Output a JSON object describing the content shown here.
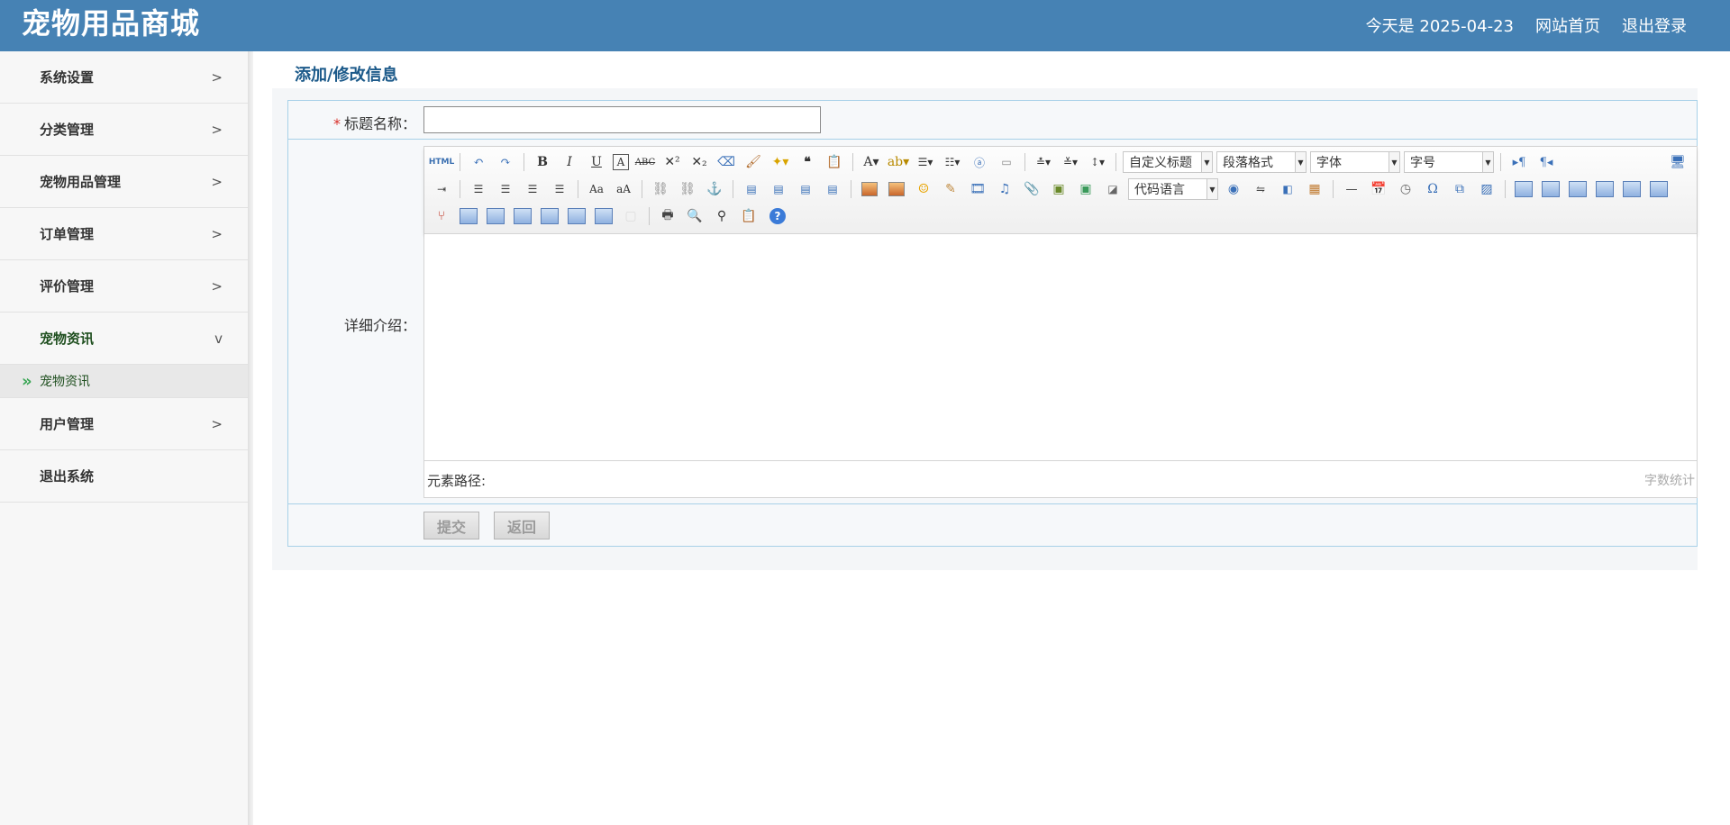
{
  "header": {
    "brand": "宠物用品商城",
    "date_text": "今天是 2025-04-23",
    "home_link": "网站首页",
    "logout_link": "退出登录"
  },
  "sidebar": {
    "items": [
      {
        "label": "系统设置",
        "chevron": ">"
      },
      {
        "label": "分类管理",
        "chevron": ">"
      },
      {
        "label": "宠物用品管理",
        "chevron": ">"
      },
      {
        "label": "订单管理",
        "chevron": ">"
      },
      {
        "label": "评价管理",
        "chevron": ">"
      },
      {
        "label": "宠物资讯",
        "chevron": "v"
      },
      {
        "label": "用户管理",
        "chevron": ">"
      },
      {
        "label": "退出系统"
      }
    ],
    "submenu": {
      "arrow": "»",
      "label": "宠物资讯"
    }
  },
  "main": {
    "page_title": "添加/修改信息",
    "form": {
      "required_mark": "*",
      "title_label": "标题名称：",
      "title_value": "",
      "detail_label": "详细介绍：",
      "editor": {
        "html_button": "HTML",
        "custom_heading": "自定义标题",
        "paragraph_format": "段落格式",
        "font_family": "字体",
        "font_size": "字号",
        "code_language": "代码语言",
        "element_path": "元素路径:",
        "word_count": "字数统计"
      },
      "submit_label": "提交",
      "back_label": "返回"
    }
  },
  "colors": {
    "header_bg": "#4682b4",
    "accent_title": "#1c5a8a",
    "form_border": "#a8d1e8",
    "required": "#d9302a"
  }
}
